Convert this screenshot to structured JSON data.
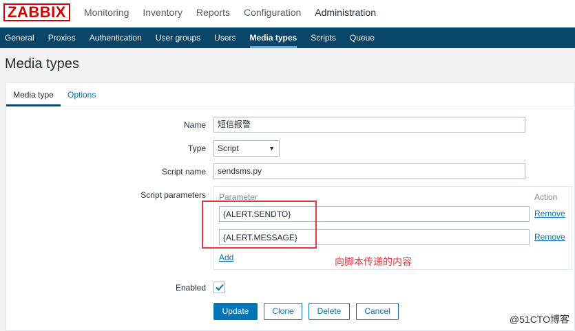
{
  "header": {
    "logo": "ZABBIX",
    "menu": [
      "Monitoring",
      "Inventory",
      "Reports",
      "Configuration",
      "Administration"
    ],
    "active_menu": "Administration"
  },
  "subnav": {
    "items": [
      "General",
      "Proxies",
      "Authentication",
      "User groups",
      "Users",
      "Media types",
      "Scripts",
      "Queue"
    ],
    "active": "Media types"
  },
  "page": {
    "title": "Media types"
  },
  "tabs": {
    "media_type": "Media type",
    "options": "Options"
  },
  "form": {
    "name_label": "Name",
    "name_value": "短信报警",
    "type_label": "Type",
    "type_value": "Script",
    "script_name_label": "Script name",
    "script_name_value": "sendsms.py",
    "script_params_label": "Script parameters",
    "params_header_parameter": "Parameter",
    "params_header_action": "Action",
    "params": [
      {
        "value": "{ALERT.SENDTO}",
        "action": "Remove"
      },
      {
        "value": "{ALERT.MESSAGE}",
        "action": "Remove"
      }
    ],
    "add_label": "Add",
    "enabled_label": "Enabled",
    "enabled": true
  },
  "buttons": {
    "update": "Update",
    "clone": "Clone",
    "delete": "Delete",
    "cancel": "Cancel"
  },
  "annotation": "向脚本传递的内容",
  "watermark": "@51CTO博客",
  "colors": {
    "header_bg": "#0a466a",
    "accent": "#0275b8",
    "logo_red": "#d40000",
    "annotation_red": "#e0393e"
  }
}
